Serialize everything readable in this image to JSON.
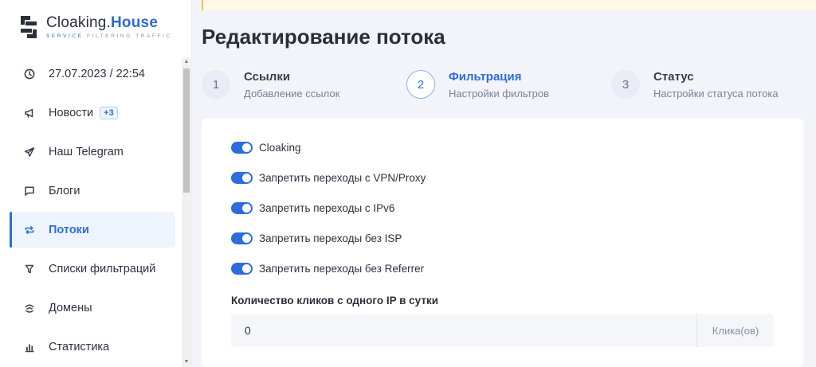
{
  "brand": {
    "name_part1": "Cloaking.",
    "name_part2": "House",
    "tagline_part1": "SERVICE",
    "tagline_part2": " FILTERING TRAFFIC",
    "accent": "#2f6ad0"
  },
  "sidebar": {
    "items": [
      {
        "label": "27.07.2023 / 22:54",
        "icon": "clock-icon"
      },
      {
        "label": "Новости",
        "icon": "megaphone-icon",
        "badge": "+3"
      },
      {
        "label": "Наш Telegram",
        "icon": "telegram-icon"
      },
      {
        "label": "Блоги",
        "icon": "chat-icon"
      },
      {
        "label": "Потоки",
        "icon": "repeat-icon",
        "active": true
      },
      {
        "label": "Списки фильтраций",
        "icon": "filter-icon"
      },
      {
        "label": "Домены",
        "icon": "globe-icon"
      },
      {
        "label": "Статистика",
        "icon": "bar-chart-icon"
      }
    ]
  },
  "page": {
    "title": "Редактирование потока"
  },
  "steps": [
    {
      "number": "1",
      "title": "Ссылки",
      "subtitle": "Добавление ссылок"
    },
    {
      "number": "2",
      "title": "Фильтрация",
      "subtitle": "Настройки фильтров",
      "current": true
    },
    {
      "number": "3",
      "title": "Статус",
      "subtitle": "Настройки статуса потока"
    }
  ],
  "filters": {
    "toggles": [
      {
        "label": "Cloaking",
        "on": true
      },
      {
        "label": "Запретить переходы с VPN/Proxy",
        "on": true
      },
      {
        "label": "Запретить переходы с IPv6",
        "on": true
      },
      {
        "label": "Запретить переходы без ISP",
        "on": true
      },
      {
        "label": "Запретить переходы без Referrer",
        "on": true
      }
    ],
    "clicks_label": "Количество кликов с одного IP в сутки",
    "clicks_value": "0",
    "clicks_suffix": "Клика(ов)"
  },
  "colors": {
    "primary": "#2d6ddb",
    "background": "#f3f4f9"
  }
}
